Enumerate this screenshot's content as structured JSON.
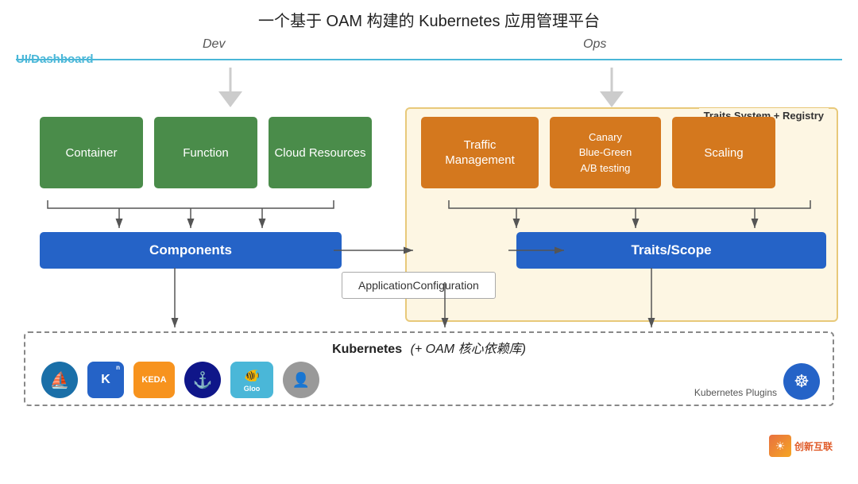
{
  "title": {
    "main": "一个基于 OAM 构建的 Kubernetes 应用管理平台"
  },
  "ui_dashboard": {
    "label": "UI/Dashboard"
  },
  "arrows": {
    "dev_label": "Dev",
    "ops_label": "Ops"
  },
  "traits_system": {
    "label": "Traits System + Registry"
  },
  "green_boxes": [
    {
      "label": "Container"
    },
    {
      "label": "Function"
    },
    {
      "label": "Cloud Resources"
    }
  ],
  "orange_boxes": [
    {
      "label": "Traffic\nManagement"
    },
    {
      "label": "Canary\nBlue-Green\nA/B testing"
    },
    {
      "label": "Scaling"
    }
  ],
  "blue_bars": [
    {
      "label": "Components"
    },
    {
      "label": "Traits/Scope"
    }
  ],
  "app_config": {
    "label": "ApplicationConfiguration"
  },
  "kubernetes": {
    "label": "Kubernetes",
    "suffix": "(+ OAM 核心依赖库)",
    "plugins_label": "Kubernetes Plugins"
  },
  "icons": [
    {
      "name": "sail",
      "symbol": "⛵",
      "color": "#1a6fa8"
    },
    {
      "name": "knative",
      "symbol": "K",
      "color": "#2563c7"
    },
    {
      "name": "keda",
      "symbol": "KEDA",
      "color": "#f7931e"
    },
    {
      "name": "helm",
      "symbol": "⚓",
      "color": "#0f1689"
    },
    {
      "name": "gloo",
      "symbol": "Gloo",
      "color": "#4ab7d8"
    },
    {
      "name": "agent",
      "symbol": "●",
      "color": "#888"
    }
  ],
  "watermark": {
    "text": "创新互联",
    "symbol": "☸"
  },
  "colors": {
    "green": "#4a8c4a",
    "orange": "#d4781e",
    "blue": "#2563c7",
    "teal": "#4ab7d8",
    "yellow_border": "#e8c97a",
    "yellow_bg": "#fdf6e3"
  }
}
